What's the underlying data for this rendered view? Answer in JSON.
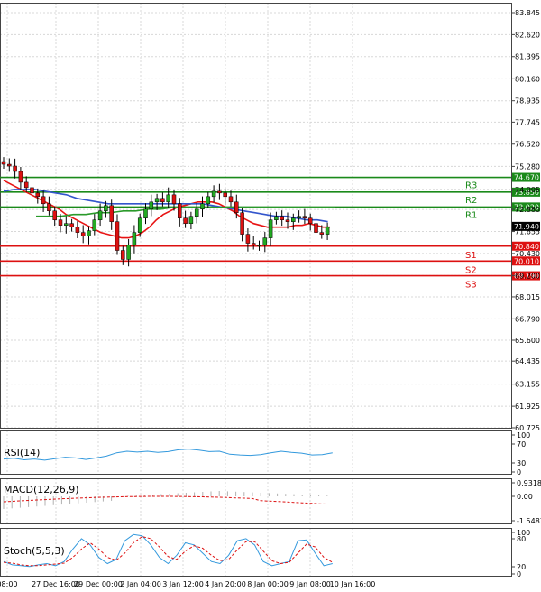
{
  "chart_data": {
    "type": "candlestick",
    "main": {
      "y_ticks": [
        "83.845",
        "82.620",
        "81.395",
        "80.160",
        "78.935",
        "77.745",
        "76.520",
        "75.280",
        "74.005",
        "72.880",
        "71.655",
        "70.430",
        "69.200",
        "68.015",
        "66.790",
        "65.600",
        "64.435",
        "63.155",
        "61.925",
        "60.725"
      ],
      "ylim": [
        60.725,
        83.845
      ],
      "x_labels": [
        "08:00",
        "27 Dec 16:00",
        "29 Dec 00:00",
        "2 Jan 04:00",
        "3 Jan 12:00",
        "4 Jan 20:00",
        "8 Jan 00:00",
        "9 Jan 08:00",
        "10 Jan 16:00"
      ],
      "last_price": "71.940",
      "levels": [
        {
          "name": "R3",
          "value": "74.670",
          "color": "#1a8a1a"
        },
        {
          "name": "R2",
          "value": "73.850",
          "color": "#1a8a1a"
        },
        {
          "name": "R1",
          "value": "73.020",
          "color": "#1a8a1a"
        },
        {
          "name": "S1",
          "value": "70.840",
          "color": "#dd1111"
        },
        {
          "name": "S2",
          "value": "70.010",
          "color": "#dd1111"
        },
        {
          "name": "S3",
          "value": "69.190",
          "color": "#dd1111"
        }
      ],
      "closes": [
        75.4,
        75.3,
        75.0,
        74.4,
        74.1,
        73.8,
        73.6,
        73.2,
        72.8,
        72.3,
        72.0,
        72.1,
        71.9,
        71.6,
        71.4,
        71.7,
        72.3,
        72.8,
        73.1,
        72.2,
        70.6,
        70.1,
        70.9,
        71.6,
        72.4,
        72.9,
        73.3,
        73.5,
        73.3,
        73.7,
        73.2,
        72.4,
        72.1,
        72.5,
        72.9,
        73.2,
        73.6,
        73.9,
        73.8,
        73.6,
        73.3,
        72.7,
        71.5,
        71.0,
        70.9,
        70.9,
        71.3,
        72.3,
        72.5,
        72.3,
        72.2,
        72.4,
        72.5,
        72.4,
        72.1,
        71.6,
        71.5,
        71.9
      ],
      "ma_red": [
        74.5,
        74.3,
        74.1,
        73.9,
        73.7,
        73.5,
        73.3,
        73.1,
        72.9,
        72.6,
        72.4,
        72.2,
        72.0,
        71.8,
        71.6,
        71.5,
        71.4,
        71.3,
        71.3,
        71.4,
        71.6,
        71.9,
        72.3,
        72.6,
        72.8,
        73.0,
        73.1,
        73.2,
        73.3,
        73.3,
        73.3,
        73.2,
        73.0,
        72.8,
        72.5,
        72.3,
        72.1,
        72.0,
        71.9,
        71.9,
        71.9,
        71.9,
        72.0,
        72.0,
        72.1,
        72.0,
        71.9,
        71.9
      ],
      "ma_blue": [
        73.9,
        74.0,
        74.0,
        74.0,
        73.9,
        73.8,
        73.7,
        73.5,
        73.4,
        73.3,
        73.2,
        73.2,
        73.2,
        73.2,
        73.2,
        73.2,
        73.2,
        73.2,
        73.2,
        73.2,
        73.1,
        73.0,
        72.9,
        72.8,
        72.7,
        72.6,
        72.5,
        72.5,
        72.4,
        72.3,
        72.3,
        72.2
      ],
      "ma_green": [
        72.5,
        72.5,
        72.5,
        72.6,
        72.6,
        72.7,
        72.7,
        72.8,
        72.8,
        72.9,
        72.9,
        73.0,
        73.0,
        73.0,
        73.0,
        73.0,
        73.0,
        73.0,
        73.0,
        73.0,
        73.0,
        73.0,
        73.0,
        73.0,
        73.0
      ]
    },
    "rsi": {
      "label": "RSI(14)",
      "y_ticks": [
        "100",
        "70",
        "30",
        "0"
      ],
      "values": [
        35,
        37,
        33,
        35,
        32,
        36,
        40,
        38,
        34,
        38,
        43,
        52,
        56,
        54,
        56,
        53,
        55,
        60,
        62,
        59,
        55,
        56,
        48,
        46,
        45,
        47,
        52,
        56,
        53,
        51,
        46,
        47,
        52
      ]
    },
    "macd": {
      "label": "MACD(12,26,9)",
      "y_ticks": [
        "0.9318",
        "0.00",
        "-1.5487"
      ]
    },
    "stoch": {
      "label": "Stoch(5,5,3)",
      "y_ticks": [
        "100",
        "80",
        "20",
        "0"
      ],
      "k": [
        30,
        22,
        20,
        18,
        22,
        25,
        20,
        30,
        60,
        85,
        70,
        40,
        25,
        35,
        80,
        95,
        92,
        70,
        40,
        25,
        45,
        75,
        70,
        50,
        30,
        25,
        45,
        80,
        85,
        70,
        30,
        20,
        25,
        30,
        80,
        82,
        50,
        20,
        25
      ],
      "d": [
        28,
        26,
        22,
        20,
        20,
        22,
        24,
        26,
        40,
        60,
        75,
        60,
        40,
        33,
        50,
        75,
        90,
        85,
        65,
        42,
        35,
        55,
        68,
        62,
        45,
        32,
        35,
        58,
        78,
        78,
        55,
        32,
        25,
        28,
        50,
        72,
        65,
        40,
        28
      ]
    }
  }
}
